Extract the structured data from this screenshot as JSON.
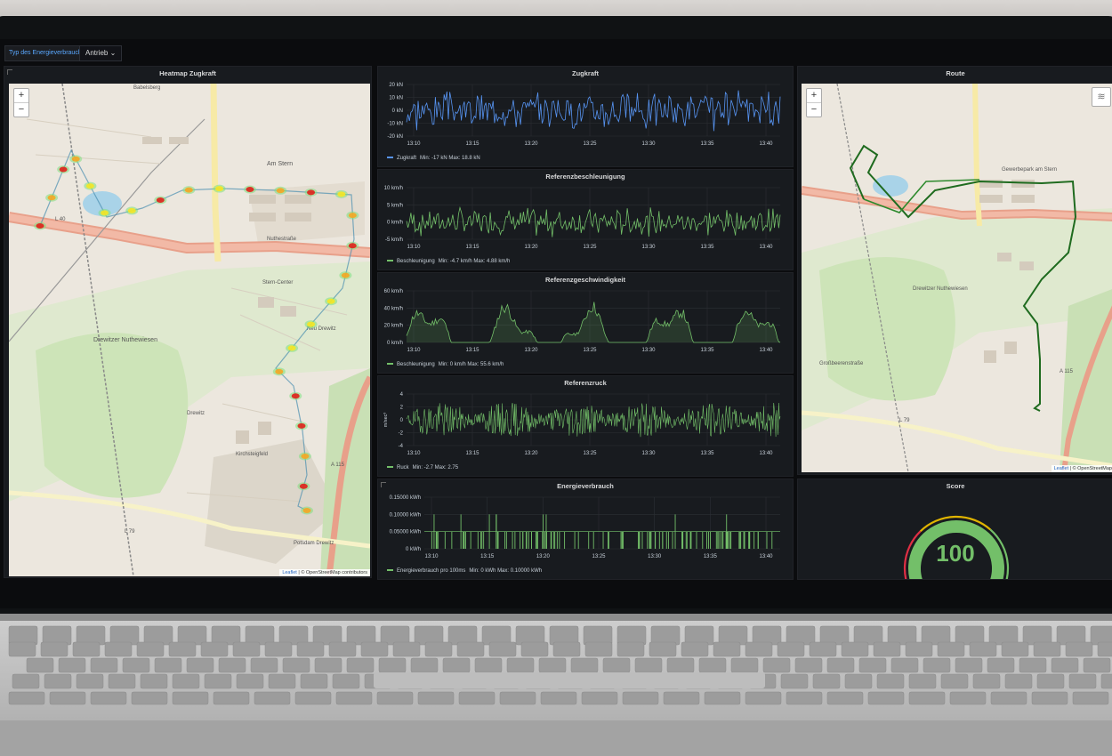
{
  "toolbar": {
    "variable_label": "Typ des Energieverbrauchs",
    "select_value": "Antrieb"
  },
  "panels": {
    "heatmap": {
      "title": "Heatmap Zugkraft",
      "attribution_link": "Leaflet",
      "attribution_text": " | © OpenStreetMap contributors"
    },
    "route": {
      "title": "Route",
      "attribution_link": "Leaflet",
      "attribution_text": " | © OpenStreetMap"
    },
    "score": {
      "title": "Score",
      "value": "100",
      "gauge_fraction": 1.0
    },
    "map_labels": [
      "Babelsberg",
      "Am Stern",
      "Drewitzer Nuthewiesen",
      "Drewitz",
      "Kirchsteigfeld",
      "Nuthestraße",
      "Stern-Center",
      "Neu Drewitz",
      "A 115",
      "L 40",
      "L 79",
      "Potsdam Drewitz",
      "Großbeerenstraße",
      "Gewerbepark am Stern"
    ]
  },
  "map_controls": {
    "zoom_in": "+",
    "zoom_out": "−"
  },
  "x_ticks": [
    "13:10",
    "13:15",
    "13:20",
    "13:25",
    "13:30",
    "13:35",
    "13:40"
  ],
  "charts": {
    "zugkraft": {
      "title": "Zugkraft",
      "color": "#5794f2",
      "y_ticks": [
        "20 kN",
        "10 kN",
        "0 kN",
        "-10 kN",
        "-20 kN"
      ],
      "y_min": -20,
      "y_max": 20,
      "legend_name": "Zugkraft",
      "legend_stats": "Min: -17 kN  Max: 18.8 kN",
      "amp": 17,
      "seed": 3
    },
    "beschleunigung": {
      "title": "Referenzbeschleunigung",
      "color": "#73bf69",
      "y_ticks": [
        "10 km/h",
        "5 km/h",
        "0 km/h",
        "-5 km/h"
      ],
      "y_min": -5,
      "y_max": 10,
      "legend_name": "Beschleunigung",
      "legend_stats": "Min: -4.7 km/h  Max: 4.88 km/h",
      "amp": 4.7,
      "seed": 7
    },
    "geschwindigkeit": {
      "title": "Referenzgeschwindigkeit",
      "color": "#73bf69",
      "y_ticks": [
        "60 km/h",
        "40 km/h",
        "20 km/h",
        "0 km/h"
      ],
      "y_min": 0,
      "y_max": 60,
      "legend_name": "Beschleunigung",
      "legend_stats": "Min: 0 km/h  Max: 55.6 km/h",
      "seed": 11
    },
    "ruck": {
      "title": "Referenzruck",
      "color": "#73bf69",
      "y_ticks": [
        "4",
        "2",
        "0",
        "-2",
        "-4"
      ],
      "y_min": -4,
      "y_max": 4,
      "y_unit": "m/sec³",
      "legend_name": "Ruck",
      "legend_stats": "Min: -2.7  Max: 2.75",
      "amp": 2.7,
      "seed": 19
    },
    "energie": {
      "title": "Energieverbrauch",
      "color": "#73bf69",
      "y_ticks": [
        "0.15000 kWh",
        "0.10000 kWh",
        "0.05000 kWh",
        "0 kWh"
      ],
      "y_min": 0,
      "y_max": 0.15,
      "legend_name": "Energieverbrauch pro 100ms",
      "legend_stats": "Min: 0 kWh  Max: 0.10000 kWh",
      "seed": 23
    }
  }
}
